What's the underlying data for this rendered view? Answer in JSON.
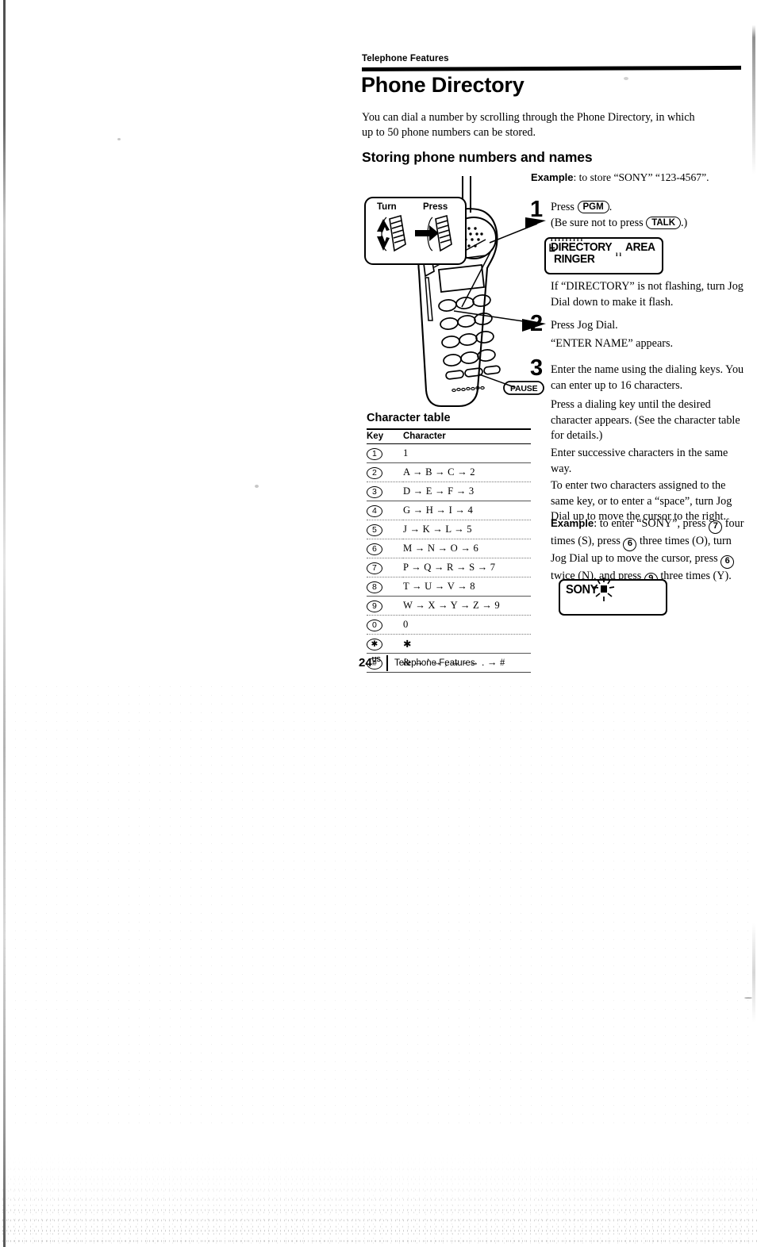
{
  "page": {
    "running_head": "Telephone Features",
    "title": "Phone Directory",
    "intro": "You can dial a number by scrolling through the Phone Directory, in which up to 50 phone numbers can be stored.",
    "section_heading": "Storing phone numbers and names",
    "example_label": "Example",
    "example_text": ": to store “SONY” “123-4567”.",
    "folio_number": "24",
    "folio_superscript": "US",
    "folio_text": "Telephone Features"
  },
  "illustration": {
    "callout_turn": "Turn",
    "callout_press": "Press",
    "pause_label": "PAUSE",
    "step_markers": [
      "1",
      "2",
      "3"
    ]
  },
  "steps": [
    {
      "number": "1",
      "line1_pre": "Press ",
      "line1_key": "PGM",
      "line1_post": ".",
      "line2_pre": "(Be sure not to press ",
      "line2_key": "TALK",
      "line2_post": ".)",
      "after": "If “DIRECTORY” is not flashing, turn Jog Dial down to make it flash."
    },
    {
      "number": "2",
      "line1": "Press Jog Dial.",
      "line2": "“ENTER  NAME” appears."
    },
    {
      "number": "3",
      "line1": "Enter the name using the dialing keys. You can enter up to 16 characters.",
      "p1": "Press a dialing key until the desired character appears. (See the character table for details.)",
      "p2": "Enter successive characters in the same way.",
      "p3": "To enter two characters assigned to the same key, or to enter a “space”, turn Jog Dial up to move the cursor to the right."
    }
  ],
  "example_block": {
    "label": "Example",
    "part1": ": to enter “SONY”, press ",
    "key1": "7",
    "part2": " four times (S), press ",
    "key2": "6",
    "part3": " three times (O), turn Jog Dial up to move the cursor, press ",
    "key3": "6",
    "part4": " twice (N), and press ",
    "key4": "9",
    "part5": " three times (Y)."
  },
  "lcd_directory": {
    "word_flashing": "DIRECTORY",
    "word_area": "AREA",
    "word_ringer": "RINGER"
  },
  "lcd_sony": {
    "text": "SONY"
  },
  "character_table": {
    "title": "Character table",
    "headers": [
      "Key",
      "Character"
    ],
    "rows": [
      {
        "key": "1",
        "chars": "1"
      },
      {
        "key": "2",
        "chars": "A → B → C → 2"
      },
      {
        "key": "3",
        "chars": "D → E → F → 3"
      },
      {
        "key": "4",
        "chars": "G → H → I → 4"
      },
      {
        "key": "5",
        "chars": "J → K → L → 5"
      },
      {
        "key": "6",
        "chars": "M → N → O → 6"
      },
      {
        "key": "7",
        "chars": "P → Q → R → S → 7"
      },
      {
        "key": "8",
        "chars": "T → U → V → 8"
      },
      {
        "key": "9",
        "chars": "W → X → Y → Z → 9"
      },
      {
        "key": "0",
        "chars": "0"
      },
      {
        "key": "✱",
        "chars": "✱"
      },
      {
        "key": "#",
        "chars": "& → ’ → , → - → . → #"
      }
    ]
  }
}
